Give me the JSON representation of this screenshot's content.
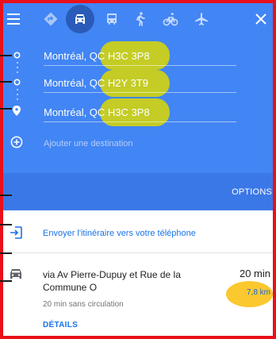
{
  "colors": {
    "header_bg": "#4285f4",
    "options_bar_bg": "#3b78e7",
    "frame_border": "#e8101a",
    "address_highlight": "#dad800",
    "distance_highlight": "#fcc82f",
    "link": "#1a73e8"
  },
  "toolbar": {
    "menu_icon": "hamburger-menu-icon",
    "modes": [
      {
        "name": "best-route",
        "icon": "diamond-turn-icon",
        "selected": false
      },
      {
        "name": "driving",
        "icon": "car-icon",
        "selected": true
      },
      {
        "name": "transit",
        "icon": "bus-icon",
        "selected": false
      },
      {
        "name": "walking",
        "icon": "walking-icon",
        "selected": false
      },
      {
        "name": "cycling",
        "icon": "bicycle-icon",
        "selected": false
      },
      {
        "name": "flight",
        "icon": "airplane-icon",
        "selected": false
      }
    ],
    "close_icon": "close-icon"
  },
  "waypoints": [
    {
      "city": "Montréal, Q",
      "postal": "C H3C 3P8",
      "marker": "origin-circle-icon"
    },
    {
      "city": "Montréal, Q",
      "postal": "C H2Y 3T9",
      "marker": "stop-circle-icon"
    },
    {
      "city": "Montréal, Q",
      "postal": "C H3C 3P8",
      "marker": "destination-pin-icon"
    }
  ],
  "add_destination": {
    "label": "Ajouter une destination",
    "icon": "add-circle-icon"
  },
  "options_label": "OPTIONS",
  "send_to_phone": {
    "label": "Envoyer l'itinéraire vers votre téléphone",
    "icon": "send-to-device-icon"
  },
  "route": {
    "icon": "car-icon",
    "title": "via Av Pierre-Dupuy et Rue de la Commune O",
    "traffic_note": "20 min sans circulation",
    "duration": "20 min",
    "distance": "7,8 km",
    "details_label": "DÉTAILS"
  }
}
